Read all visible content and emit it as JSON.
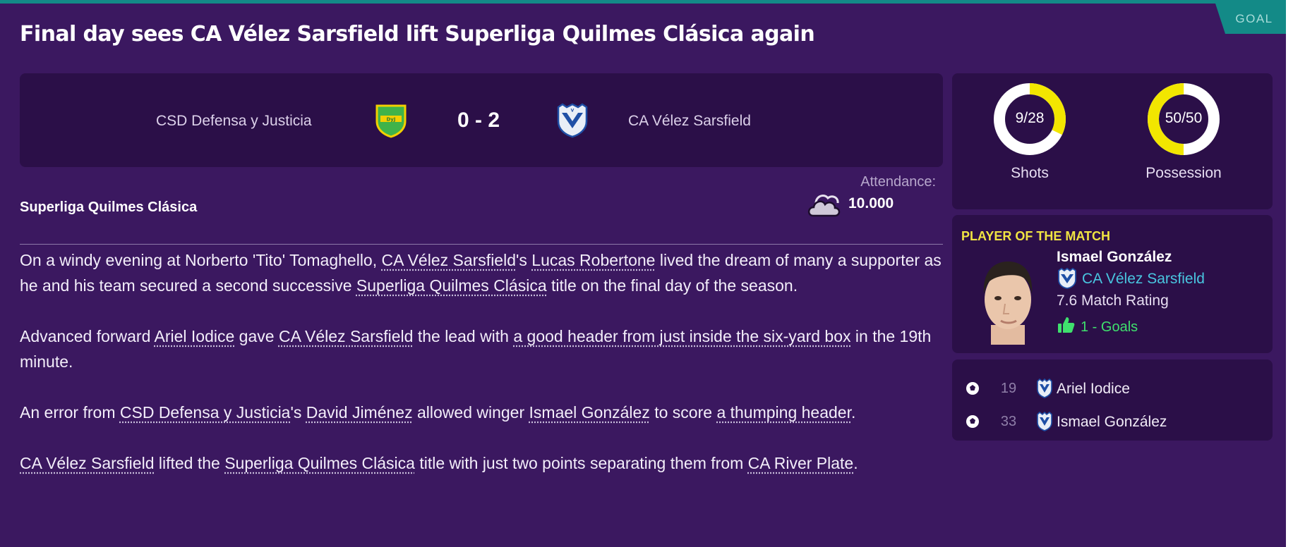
{
  "header": {
    "title": "Final day sees CA Vélez Sarsfield lift Superliga Quilmes Clásica again",
    "badge": "GOAL"
  },
  "match": {
    "home_team": "CSD Defensa y Justicia",
    "away_team": "CA Vélez Sarsfield",
    "score": "0 - 2",
    "home_crest_icon": "defensa-crest-icon",
    "away_crest_icon": "velez-crest-icon",
    "competition": "Superliga Quilmes Clásica",
    "attendance_label": "Attendance:",
    "attendance_value": "10.000",
    "weather_icon": "cloudy-weather-icon"
  },
  "article": {
    "p1": {
      "t1": "On a windy evening at Norberto 'Tito' Tomaghello, ",
      "l1": "CA Vélez Sarsfield",
      "t2": "'s ",
      "l2": "Lucas Robertone",
      "t3": " lived the dream of many a supporter as he and his team secured a second successive ",
      "l3": "Superliga Quilmes Clásica",
      "t4": " title on the final day of the season."
    },
    "p2": {
      "t1": "Advanced forward ",
      "l1": "Ariel Iodice",
      "t2": " gave ",
      "l2": "CA Vélez Sarsfield",
      "t3": " the lead with ",
      "l3": "a good header from just inside the six-yard box",
      "t4": " in the 19th minute."
    },
    "p3": {
      "t1": "An error from ",
      "l1": "CSD Defensa y Justicia",
      "t2": "'s ",
      "l2": "David Jiménez",
      "t3": " allowed winger ",
      "l3": "Ismael González",
      "t4": " to score ",
      "l4": "a thumping header",
      "t5": "."
    },
    "p4": {
      "l1": "CA Vélez Sarsfield",
      "t1": " lifted the ",
      "l2": "Superliga Quilmes Clásica",
      "t2": " title with just two points separating them from ",
      "l3": "CA River Plate",
      "t3": "."
    }
  },
  "stats": {
    "shots": {
      "text": "9/28",
      "label": "Shots",
      "fraction": 0.3214
    },
    "possession": {
      "text": "50/50",
      "label": "Possession",
      "fraction": 0.5
    },
    "colors": {
      "highlight": "#f2e600",
      "base": "#ffffff"
    }
  },
  "player_of_match": {
    "heading": "PLAYER OF THE MATCH",
    "name": "Ismael González",
    "club": "CA Vélez Sarsfield",
    "rating": "7.6 Match Rating",
    "goals": "1 - Goals",
    "goals_icon": "thumbs-up-icon"
  },
  "scorers": [
    {
      "minute": "19",
      "name": "Ariel Iodice",
      "icon": "football-icon"
    },
    {
      "minute": "33",
      "name": "Ismael González",
      "icon": "football-icon"
    }
  ],
  "colors": {
    "panel_bg": "#3b1860",
    "card_bg": "#2b0f48",
    "accent_teal": "#138a87",
    "potm_yellow": "#f0e442",
    "club_link": "#49c6e0",
    "goals_green": "#3fe06d"
  }
}
